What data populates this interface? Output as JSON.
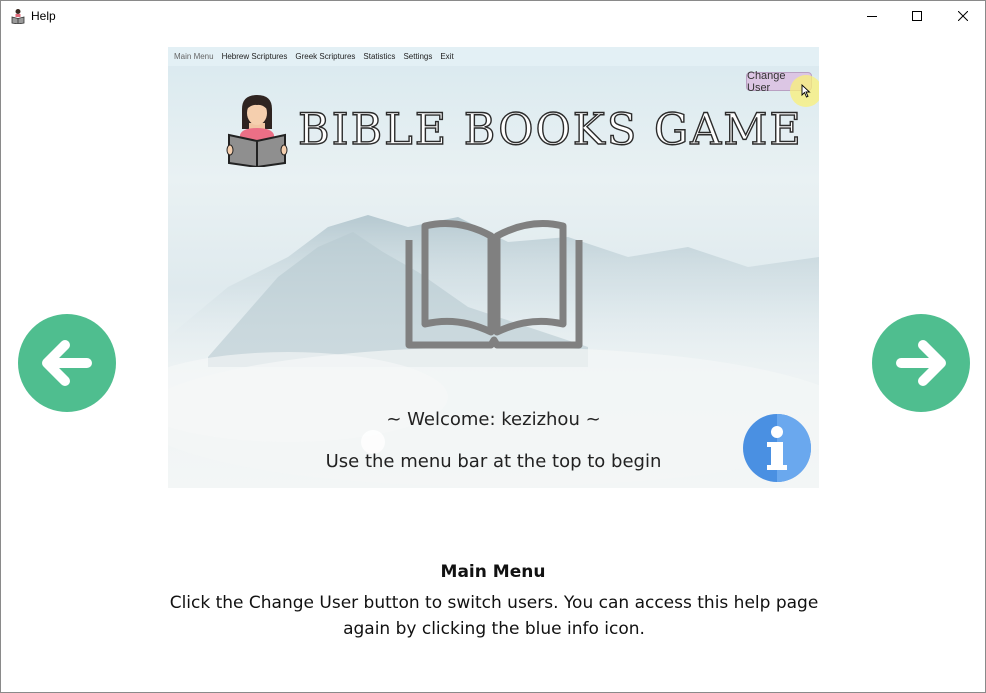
{
  "window": {
    "title": "Help"
  },
  "screenshot": {
    "menu": [
      "Main Menu",
      "Hebrew Scriptures",
      "Greek Scriptures",
      "Statistics",
      "Settings",
      "Exit"
    ],
    "change_user_label": "Change User",
    "game_title": "BIBLE BOOKS GAME",
    "welcome_text": "~  Welcome:  kezizhou  ~",
    "begin_text": "Use the menu bar at the top to begin"
  },
  "caption": {
    "title": "Main Menu",
    "body": "Click the Change User button to switch users. You can access this help page again by clicking the blue info icon."
  },
  "colors": {
    "nav_button": "#4fbe8f",
    "info_icon": "#4a90e2",
    "change_user_bg": "#dcc6e4"
  }
}
